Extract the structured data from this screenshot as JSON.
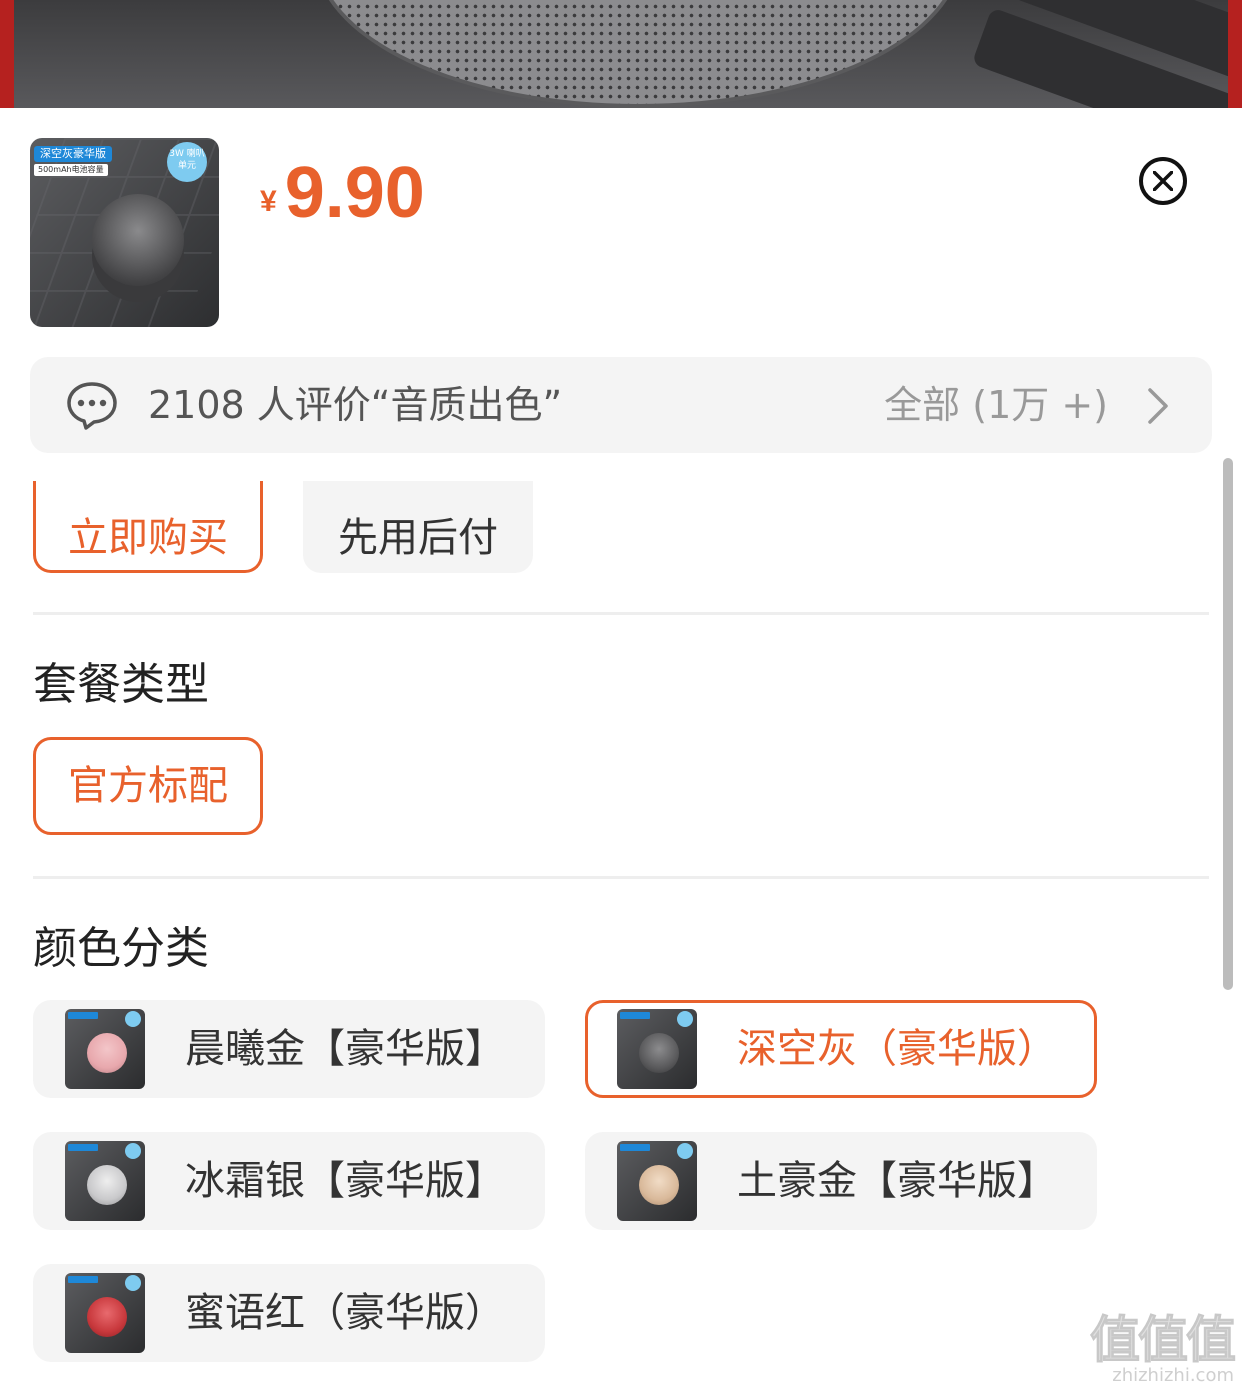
{
  "product": {
    "thumb_tag": "深空灰豪华版",
    "thumb_sub": "500mAh电池容量",
    "thumb_badge": "3W 喇叭单元",
    "currency_symbol": "¥",
    "price": "9.90"
  },
  "review": {
    "text": "2108 人评价“音质出色”",
    "all_label": "全部 (1万 +)"
  },
  "purchase_options": [
    {
      "label": "立即购买",
      "selected": true
    },
    {
      "label": "先用后付",
      "selected": false
    }
  ],
  "package": {
    "title": "套餐类型",
    "options": [
      {
        "label": "官方标配",
        "selected": true
      }
    ]
  },
  "color": {
    "title": "颜色分类",
    "options": [
      {
        "label": "晨曦金【豪华版】",
        "swatch": "#e8a8ad",
        "selected": false
      },
      {
        "label": "深空灰（豪华版）",
        "swatch": "#6a6a6c",
        "selected": true
      },
      {
        "label": "冰霜银【豪华版】",
        "swatch": "#c9c9cb",
        "selected": false
      },
      {
        "label": "土豪金【豪华版】",
        "swatch": "#d9b99a",
        "selected": false
      },
      {
        "label": "蜜语红（豪华版）",
        "swatch": "#c8383c",
        "selected": false
      }
    ]
  },
  "watermark": {
    "glyphs": "值值值",
    "url": "zhizhizhi.com"
  },
  "colors": {
    "accent": "#e8612c",
    "pill_bg": "#f4f4f4",
    "backdrop_frame": "#b5211f"
  }
}
